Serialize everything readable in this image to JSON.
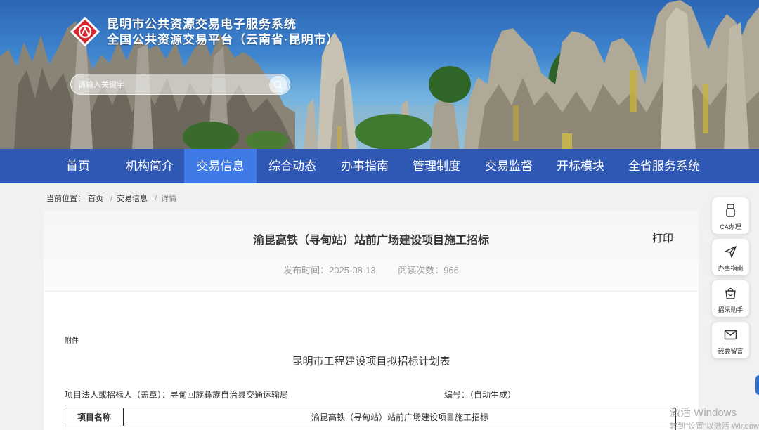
{
  "header": {
    "title_line1": "昆明市公共资源交易电子服务系统",
    "title_line2": "全国公共资源交易平台（云南省·昆明市）",
    "search_placeholder": "请输入关键字"
  },
  "nav": {
    "items": [
      "首页",
      "机构简介",
      "交易信息",
      "综合动态",
      "办事指南",
      "管理制度",
      "交易监督",
      "开标模块",
      "全省服务系统"
    ],
    "active_index": 2
  },
  "breadcrumb": {
    "prefix": "当前位置：",
    "items": [
      "首页",
      "交易信息",
      "详情"
    ]
  },
  "article": {
    "title": "渝昆高铁（寻甸站）站前广场建设项目施工招标",
    "print_label": "打印",
    "publish_label": "发布时间：",
    "publish_date": "2025-08-13",
    "read_label": "阅读次数：",
    "read_count": "966"
  },
  "document": {
    "attachment_label": "附件",
    "title": "昆明市工程建设项目拟招标计划表",
    "legal_person": "项目法人或招标人（盖章）：寻甸回族彝族自治县交通运输局",
    "serial": "编号：（自动生成）",
    "table": {
      "header_label": "项目名称",
      "header_value": "渝昆高铁（寻甸站）站前广场建设项目施工招标"
    }
  },
  "sidebar": {
    "items": [
      {
        "label": "CA办理",
        "icon": "usb-key-icon"
      },
      {
        "label": "办事指南",
        "icon": "paper-plane-icon"
      },
      {
        "label": "招采助手",
        "icon": "shopping-bag-icon"
      },
      {
        "label": "我要留言",
        "icon": "envelope-icon"
      }
    ]
  },
  "watermark": {
    "line1": "激活 Windows",
    "line2": "转到\"设置\"以激活 Windows"
  },
  "colors": {
    "nav_bg": "#2f57b4",
    "nav_active": "#3f7be6",
    "logo_red": "#d9242b"
  }
}
